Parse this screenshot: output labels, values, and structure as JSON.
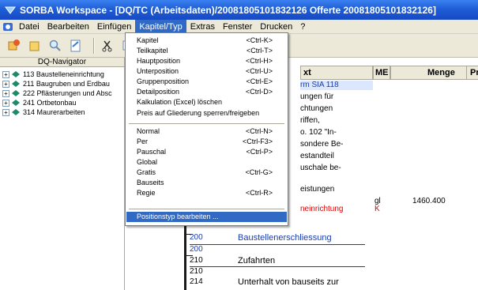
{
  "window": {
    "title": "SORBA Workspace - [DQ/TC (Arbeitsdaten)/20081805101832126 Offerte 20081805101832126]"
  },
  "menubar": {
    "items": [
      "Datei",
      "Bearbeiten",
      "Einfügen",
      "Kapitel/Typ",
      "Extras",
      "Fenster",
      "Drucken",
      "?"
    ]
  },
  "navigator": {
    "title": "DQ-Navigator",
    "items": [
      {
        "label": "113 Baustelleneinrichtung"
      },
      {
        "label": "211 Baugruben und Erdbau"
      },
      {
        "label": "222 Pflästerungen und Absc"
      },
      {
        "label": "241 Ortbetonbau"
      },
      {
        "label": "314 Maurerarbeiten"
      }
    ]
  },
  "columns": {
    "text": "xt",
    "me": "ME",
    "menge": "Menge",
    "pr": "Pr"
  },
  "doc": {
    "lines": [
      {
        "text": "rm SIA 118"
      },
      {
        "text": "ungen für"
      },
      {
        "text": "chtungen"
      },
      {
        "text": "riffen,"
      },
      {
        "text": "o. 102 \"In-"
      },
      {
        "text": "sondere Be-"
      },
      {
        "text": "estandteil"
      },
      {
        "text": "uschale be-"
      },
      {
        "text": "eistungen"
      },
      {
        "text": "neinrichtung"
      }
    ],
    "me_gl": "gl",
    "menge_value": "1460.400",
    "k_mark": "K",
    "rows": [
      {
        "num": "200",
        "text": "Baustellenerschliessung"
      },
      {
        "num": "200",
        "text": ""
      },
      {
        "num": "210",
        "text": "Zufahrten"
      },
      {
        "num": "210",
        "text": ""
      },
      {
        "num": "214",
        "text": "Unterhalt von bauseits zur"
      }
    ]
  },
  "dropdown": {
    "items": [
      {
        "label": "Kapitel",
        "shortcut": "<Ctrl-K>"
      },
      {
        "label": "Teilkapitel",
        "shortcut": "<Ctrl-T>"
      },
      {
        "label": "Hauptposition",
        "shortcut": "<Ctrl-H>"
      },
      {
        "label": "Unterposition",
        "shortcut": "<Ctrl-U>"
      },
      {
        "label": "Gruppenposition",
        "shortcut": "<Ctrl-E>"
      },
      {
        "label": "Detailposition",
        "shortcut": "<Ctrl-D>"
      },
      {
        "label": "Kalkulation (Excel) löschen",
        "shortcut": ""
      },
      {
        "label": "Preis auf Gliederung sperren/freigeben",
        "shortcut": ""
      },
      {
        "label": "Normal",
        "shortcut": "<Ctrl-N>"
      },
      {
        "label": "Per",
        "shortcut": "<Ctrl-F3>"
      },
      {
        "label": "Pauschal",
        "shortcut": "<Ctrl-P>"
      },
      {
        "label": "Global",
        "shortcut": ""
      },
      {
        "label": "Gratis",
        "shortcut": "<Ctrl-G>"
      },
      {
        "label": "Bauseits",
        "shortcut": ""
      },
      {
        "label": "Regie",
        "shortcut": "<Ctrl-R>"
      },
      {
        "label": "Positionstyp bearbeiten ...",
        "shortcut": ""
      }
    ]
  },
  "colors": {
    "titlebar": "#1f5ed6",
    "highlight": "#316ac5",
    "link_blue": "#1a3cb0",
    "alert_red": "#e00000"
  }
}
